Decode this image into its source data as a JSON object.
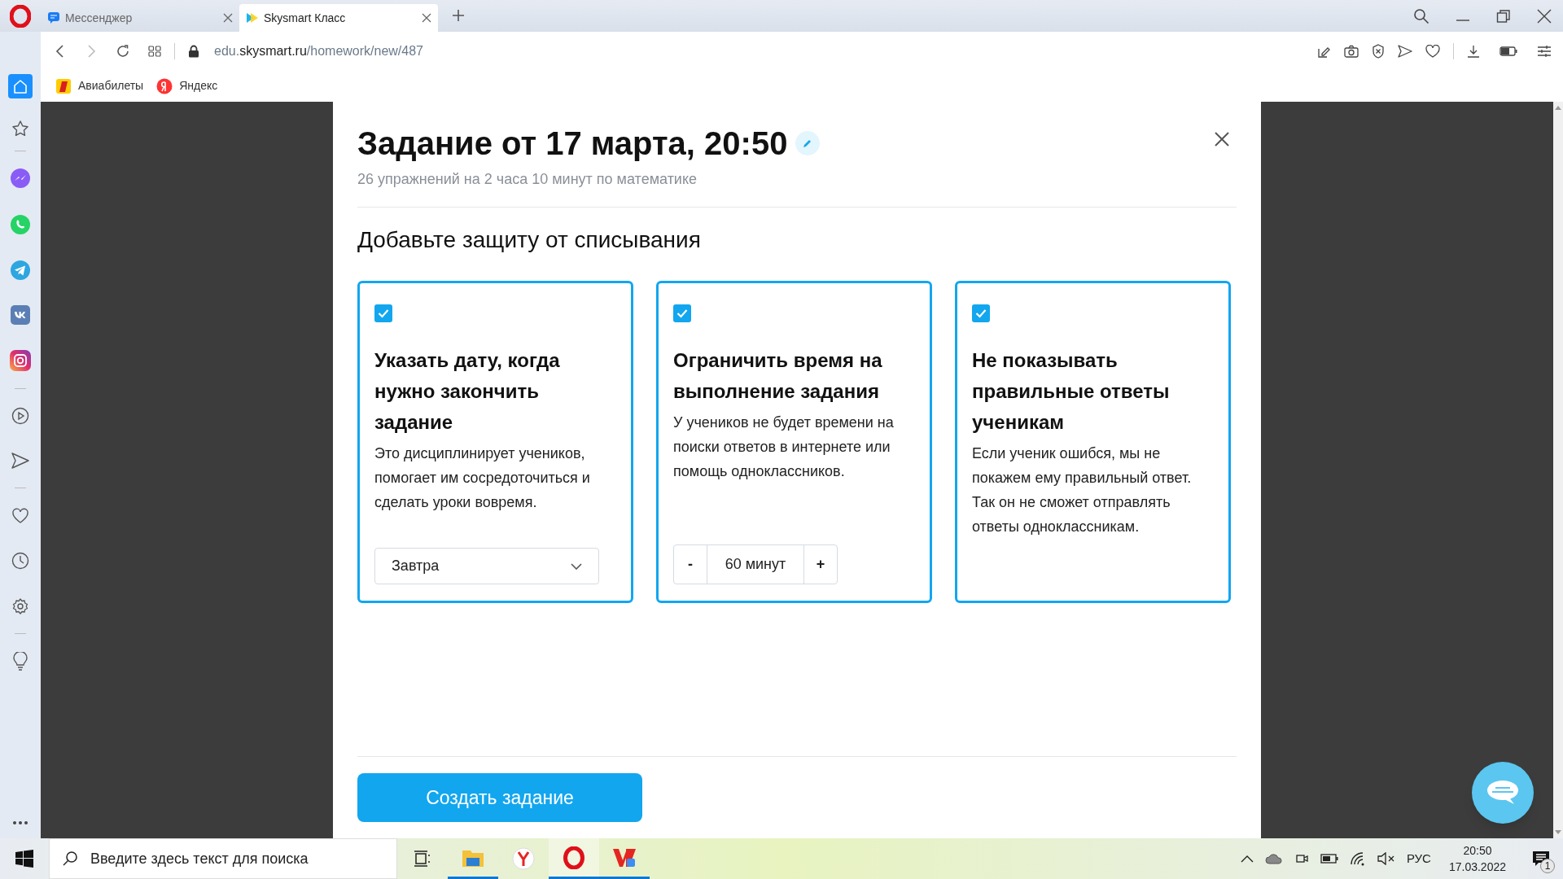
{
  "browser": {
    "tabs": [
      {
        "title": "Мессенджер",
        "selected": false
      },
      {
        "title": "Skysmart Класс",
        "selected": true
      }
    ],
    "address": {
      "prefix": "edu.",
      "domain": "skysmart.ru",
      "path": "/homework/new/487"
    },
    "bookmarks": [
      "Авиабилеты",
      "Яндекс"
    ]
  },
  "modal": {
    "title": "Задание от 17 марта, 20:50",
    "subtitle": "26 упражнений на 2 часа 10 минут по математике",
    "heading": "Добавьте защиту от списывания",
    "cards": [
      {
        "checked": true,
        "title": "Указать дату, когда нужно закончить задание",
        "description": "Это дисциплинирует учеников, помогает им сосредоточиться и сделать уроки вовремя.",
        "control": {
          "kind": "dropdown",
          "value": "Завтра"
        }
      },
      {
        "checked": true,
        "title": "Ограничить время на выполнение задания",
        "description": "У учеников не будет времени на поиски ответов в интернете или помощь одноклассников.",
        "control": {
          "kind": "stepper",
          "minus": "-",
          "value": "60 минут",
          "plus": "+"
        }
      },
      {
        "checked": true,
        "title": "Не показывать правильные ответы ученикам",
        "description": "Если ученик ошибся, мы не покажем ему правильный ответ. Так он не сможет отправлять ответы одноклассникам."
      }
    ],
    "button": "Создать задание"
  },
  "taskbar": {
    "search_placeholder": "Введите здесь текст для поиска",
    "language": "РУС",
    "time": "20:50",
    "date": "17.03.2022",
    "notifications": "1"
  }
}
